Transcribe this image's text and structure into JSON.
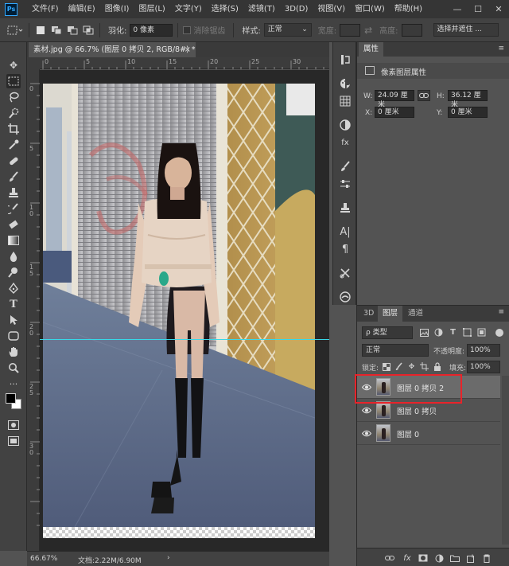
{
  "app": {
    "logo": "Ps",
    "menu": [
      "文件(F)",
      "编辑(E)",
      "图像(I)",
      "图层(L)",
      "文字(Y)",
      "选择(S)",
      "滤镜(T)",
      "3D(D)",
      "视图(V)",
      "窗口(W)",
      "帮助(H)"
    ],
    "window_controls": [
      "—",
      "☐",
      "✕"
    ]
  },
  "options": {
    "feather_label": "羽化:",
    "feather_value": "0 像素",
    "antialias_label": "消除锯齿",
    "style_label": "样式:",
    "style_value": "正常",
    "width_label": "宽度:",
    "height_label": "高度:",
    "select_mask_button": "选择并遮住 ..."
  },
  "document": {
    "tab_title": "素材.jpg @ 66.7% (图层 0 拷贝 2, RGB/8#) *",
    "close": "×",
    "ruler_top": [
      "0",
      "5",
      "10",
      "15",
      "20",
      "25",
      "30"
    ],
    "ruler_left": [
      "0",
      "5",
      "1\n0",
      "1\n5",
      "2\n0",
      "2\n5",
      "3\n0"
    ]
  },
  "status": {
    "zoom": "66.67%",
    "doc_info": "文档:2.22M/6.90M",
    "arrow": "›"
  },
  "properties": {
    "tab": "属性",
    "subtitle": "像素图层属性",
    "w_label": "W:",
    "w_value": "24.09 厘米",
    "h_label": "H:",
    "h_value": "36.12 厘米",
    "x_label": "X:",
    "x_value": "0 厘米",
    "y_label": "Y:",
    "y_value": "0 厘米"
  },
  "layers_panel": {
    "tabs": [
      "3D",
      "图层",
      "通道"
    ],
    "filter_kind": "ρ 类型",
    "blend_mode": "正常",
    "opacity_label": "不透明度:",
    "opacity_value": "100%",
    "lock_label": "锁定:",
    "fill_label": "填充:",
    "fill_value": "100%",
    "layers": [
      {
        "name": "图层 0 拷贝 2",
        "selected": true,
        "visible": true
      },
      {
        "name": "图层 0 拷贝",
        "selected": false,
        "visible": true
      },
      {
        "name": "图层 0",
        "selected": false,
        "visible": true
      }
    ]
  },
  "colors": {
    "guide": "#38d8e8",
    "highlight": "#e8232a"
  }
}
